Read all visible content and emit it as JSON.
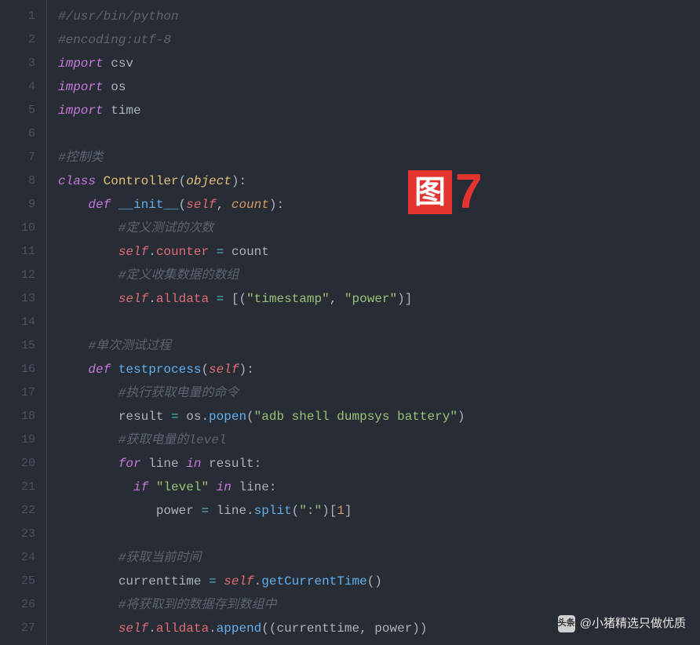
{
  "gutter": {
    "start": 1,
    "end": 27
  },
  "code": {
    "lines": [
      [
        [
          "comment",
          "#/usr/bin/python"
        ]
      ],
      [
        [
          "comment",
          "#encoding:utf-8"
        ]
      ],
      [
        [
          "keyword",
          "import"
        ],
        [
          "name",
          " csv"
        ]
      ],
      [
        [
          "keyword",
          "import"
        ],
        [
          "name",
          " os"
        ]
      ],
      [
        [
          "keyword",
          "import"
        ],
        [
          "name",
          " time"
        ]
      ],
      [],
      [
        [
          "comment",
          "#控制类"
        ]
      ],
      [
        [
          "def",
          "class "
        ],
        [
          "class",
          "Controller"
        ],
        [
          "punct",
          "("
        ],
        [
          "builtin",
          "object"
        ],
        [
          "punct",
          ")"
        ],
        [
          "punct",
          ":"
        ]
      ],
      [
        [
          "name",
          "    "
        ],
        [
          "def",
          "def "
        ],
        [
          "func",
          "__init__"
        ],
        [
          "punct",
          "("
        ],
        [
          "self",
          "self"
        ],
        [
          "punct",
          ", "
        ],
        [
          "param",
          "count"
        ],
        [
          "punct",
          ")"
        ],
        [
          "punct",
          ":"
        ]
      ],
      [
        [
          "name",
          "        "
        ],
        [
          "comment",
          "#定义测试的次数"
        ]
      ],
      [
        [
          "name",
          "        "
        ],
        [
          "self",
          "self"
        ],
        [
          "punct",
          "."
        ],
        [
          "attr",
          "counter"
        ],
        [
          "punct",
          " "
        ],
        [
          "op",
          "="
        ],
        [
          "punct",
          " count"
        ]
      ],
      [
        [
          "name",
          "        "
        ],
        [
          "comment",
          "#定义收集数据的数组"
        ]
      ],
      [
        [
          "name",
          "        "
        ],
        [
          "self",
          "self"
        ],
        [
          "punct",
          "."
        ],
        [
          "attr",
          "alldata"
        ],
        [
          "punct",
          " "
        ],
        [
          "op",
          "="
        ],
        [
          "punct",
          " [("
        ],
        [
          "string",
          "\"timestamp\""
        ],
        [
          "punct",
          ", "
        ],
        [
          "string",
          "\"power\""
        ],
        [
          "punct",
          ")]"
        ]
      ],
      [],
      [
        [
          "name",
          "    "
        ],
        [
          "comment",
          "#单次测试过程"
        ]
      ],
      [
        [
          "name",
          "    "
        ],
        [
          "def",
          "def "
        ],
        [
          "func",
          "testprocess"
        ],
        [
          "punct",
          "("
        ],
        [
          "self",
          "self"
        ],
        [
          "punct",
          ")"
        ],
        [
          "punct",
          ":"
        ]
      ],
      [
        [
          "name",
          "        "
        ],
        [
          "comment",
          "#执行获取电量的命令"
        ]
      ],
      [
        [
          "name",
          "        result "
        ],
        [
          "op",
          "="
        ],
        [
          "punct",
          " os."
        ],
        [
          "func",
          "popen"
        ],
        [
          "punct",
          "("
        ],
        [
          "string",
          "\"adb shell dumpsys battery\""
        ],
        [
          "punct",
          ")"
        ]
      ],
      [
        [
          "name",
          "        "
        ],
        [
          "comment",
          "#获取电量的level"
        ]
      ],
      [
        [
          "name",
          "        "
        ],
        [
          "keyword",
          "for"
        ],
        [
          "name",
          " line "
        ],
        [
          "keyword",
          "in"
        ],
        [
          "name",
          " result"
        ],
        [
          "punct",
          ":"
        ]
      ],
      [
        [
          "name",
          "          "
        ],
        [
          "keyword",
          "if"
        ],
        [
          "punct",
          " "
        ],
        [
          "string",
          "\"level\""
        ],
        [
          "punct",
          " "
        ],
        [
          "keyword",
          "in"
        ],
        [
          "name",
          " line"
        ],
        [
          "punct",
          ":"
        ]
      ],
      [
        [
          "name",
          "             power "
        ],
        [
          "op",
          "="
        ],
        [
          "punct",
          " line."
        ],
        [
          "func",
          "split"
        ],
        [
          "punct",
          "("
        ],
        [
          "string",
          "\":\""
        ],
        [
          "punct",
          ")["
        ],
        [
          "number",
          "1"
        ],
        [
          "punct",
          "]"
        ]
      ],
      [],
      [
        [
          "name",
          "        "
        ],
        [
          "comment",
          "#获取当前时间"
        ]
      ],
      [
        [
          "name",
          "        currenttime "
        ],
        [
          "op",
          "="
        ],
        [
          "punct",
          " "
        ],
        [
          "self",
          "self"
        ],
        [
          "punct",
          "."
        ],
        [
          "func",
          "getCurrentTime"
        ],
        [
          "punct",
          "()"
        ]
      ],
      [
        [
          "name",
          "        "
        ],
        [
          "comment",
          "#将获取到的数据存到数组中"
        ]
      ],
      [
        [
          "name",
          "        "
        ],
        [
          "self",
          "self"
        ],
        [
          "punct",
          "."
        ],
        [
          "attr",
          "alldata"
        ],
        [
          "punct",
          "."
        ],
        [
          "func",
          "append"
        ],
        [
          "punct",
          "((currenttime, power))"
        ]
      ]
    ]
  },
  "overlay": {
    "label": "图",
    "number": "7"
  },
  "watermark": {
    "prefix": "头条",
    "suffix": "@小猪精选只做优质",
    "icon": "头条"
  }
}
